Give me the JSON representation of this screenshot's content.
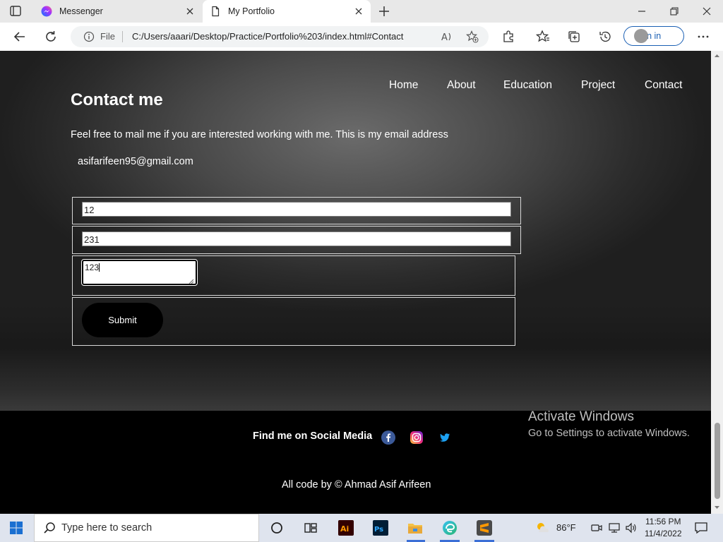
{
  "browser": {
    "tabs": [
      {
        "title": "Messenger",
        "active": false
      },
      {
        "title": "My Portfolio",
        "active": true
      }
    ],
    "url_scheme_label": "File",
    "url": "C:/Users/aaari/Desktop/Practice/Portfolio%203/index.html#Contact",
    "signin_label": "Sign in"
  },
  "nav": {
    "items": [
      "Home",
      "About",
      "Education",
      "Project",
      "Contact"
    ]
  },
  "contact": {
    "title": "Contact me",
    "intro": "Feel free to mail me if you are interested working with me. This is my email address",
    "email": "asifarifeen95@gmail.com",
    "form": {
      "field1_value": "12",
      "field2_value": "231",
      "message_value": "123",
      "submit_label": "Submit"
    }
  },
  "footer": {
    "social_label": "Find me on Social Media",
    "social_icons": [
      "facebook-icon",
      "instagram-icon",
      "twitter-icon"
    ],
    "copyright": "All code by © Ahmad Asif Arifeen"
  },
  "watermark": {
    "title": "Activate Windows",
    "subtitle": "Go to Settings to activate Windows."
  },
  "taskbar": {
    "search_placeholder": "Type here to search",
    "temperature": "86°F",
    "time": "11:56 PM",
    "date": "11/4/2022"
  },
  "colors": {
    "brand_blue": "#1a5fb4",
    "page_bg_dark": "#2c2c2c",
    "footer_bg": "#000000"
  }
}
